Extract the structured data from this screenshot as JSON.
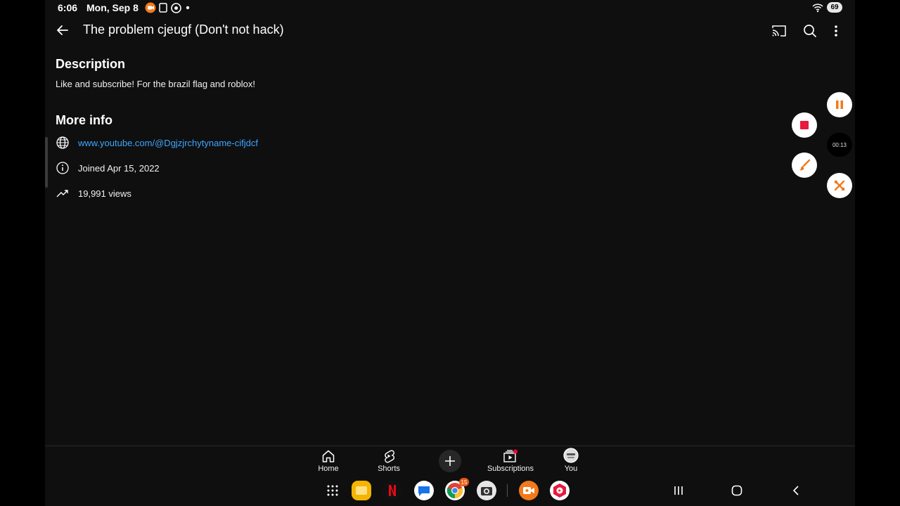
{
  "status_bar": {
    "time": "6:06",
    "date": "Mon, Sep 8",
    "battery": "69"
  },
  "header": {
    "title": "The problem cjeugf (Don't not hack)"
  },
  "description": {
    "heading": "Description",
    "text": "Like and subscribe! For the brazil flag and roblox!"
  },
  "more_info": {
    "heading": "More info",
    "link": "www.youtube.com/@Dgjzjrchytyname-cifjdcf",
    "joined": "Joined Apr 15, 2022",
    "views": "19,991 views"
  },
  "recorder": {
    "timer": "00:13",
    "accent": "#f27a1a",
    "stop_color": "#e8193c"
  },
  "bottom_nav": {
    "home": "Home",
    "shorts": "Shorts",
    "subscriptions": "Subscriptions",
    "you": "You"
  },
  "taskbar": {
    "chrome_badge": "15"
  },
  "colors": {
    "background": "#0f0f0f",
    "link": "#3ea6ff"
  }
}
